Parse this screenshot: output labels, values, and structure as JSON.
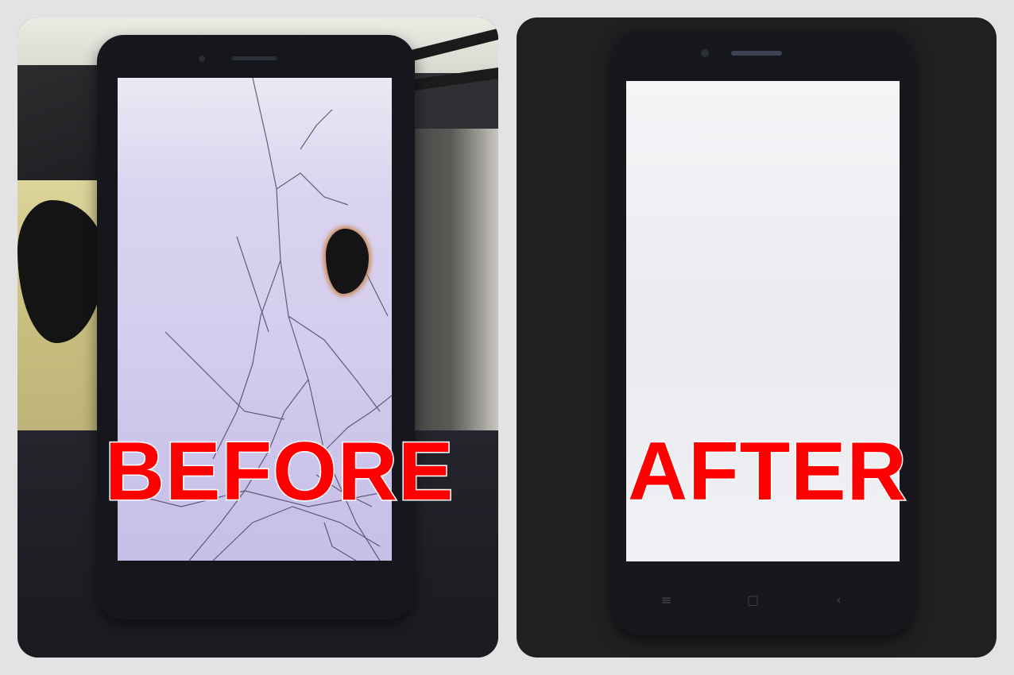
{
  "panels": {
    "before": {
      "caption": "BEFORE"
    },
    "after": {
      "caption": "AFTER"
    }
  },
  "icons": {
    "nav_menu": "≡",
    "nav_home": "▢",
    "nav_back": "‹"
  },
  "colors": {
    "caption_fill": "#ff0000",
    "caption_outline": "#ffffff",
    "page_background": "#e3e3e3"
  }
}
